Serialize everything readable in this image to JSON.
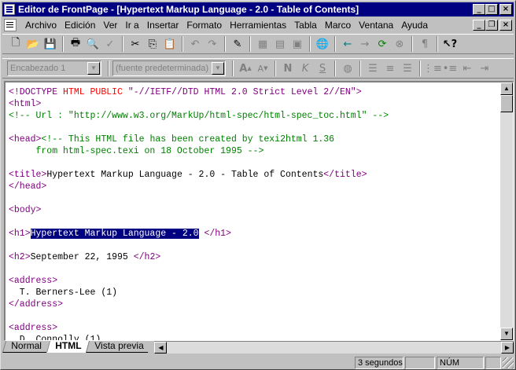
{
  "window": {
    "title": "Editor de FrontPage - [Hypertext Markup Language - 2.0 - Table of Contents]",
    "buttons": {
      "minimize": "_",
      "maximize": "□",
      "close": "×"
    }
  },
  "menu": {
    "items": [
      "Archivo",
      "Edición",
      "Ver",
      "Ir a",
      "Insertar",
      "Formato",
      "Herramientas",
      "Tabla",
      "Marco",
      "Ventana",
      "Ayuda"
    ],
    "mdi": {
      "minimize": "_",
      "restore": "❐",
      "close": "×"
    }
  },
  "format_toolbar": {
    "style_combo": "Encabezado 1",
    "font_combo": "(fuente predeterminada)"
  },
  "code_lines": [
    [
      {
        "c": "tag",
        "t": "<!DOCTYPE "
      },
      {
        "c": "attr",
        "t": "HTML PUBLIC "
      },
      {
        "c": "tag",
        "t": "\"-//IETF//DTD HTML 2.0 Strict Level 2//EN\">"
      }
    ],
    [
      {
        "c": "tag",
        "t": "<html>"
      }
    ],
    [
      {
        "c": "comment",
        "t": "<!-- Url : \"http://www.w3.org/MarkUp/html-spec/html-spec_toc.html\" -->"
      }
    ],
    [],
    [
      {
        "c": "tag",
        "t": "<head>"
      },
      {
        "c": "comment",
        "t": "<!-- This HTML file has been created by texi2html 1.36"
      }
    ],
    [
      {
        "c": "comment",
        "t": "     from html-spec.texi on 18 October 1995 -->"
      }
    ],
    [],
    [
      {
        "c": "tag",
        "t": "<title>"
      },
      {
        "c": "txt",
        "t": "Hypertext Markup Language - 2.0 - Table of Contents"
      },
      {
        "c": "tag",
        "t": "</title>"
      }
    ],
    [
      {
        "c": "tag",
        "t": "</head>"
      }
    ],
    [],
    [
      {
        "c": "tag",
        "t": "<body>"
      }
    ],
    [],
    [
      {
        "c": "tag",
        "t": "<h1>"
      },
      {
        "c": "sel",
        "t": "Hypertext Markup Language - 2.0"
      },
      {
        "c": "txt",
        "t": " "
      },
      {
        "c": "tag",
        "t": "</h1>"
      }
    ],
    [],
    [
      {
        "c": "tag",
        "t": "<h2>"
      },
      {
        "c": "txt",
        "t": "September 22, 1995 "
      },
      {
        "c": "tag",
        "t": "</h2>"
      }
    ],
    [],
    [
      {
        "c": "tag",
        "t": "<address>"
      }
    ],
    [
      {
        "c": "txt",
        "t": "  T. Berners-Lee (1)"
      }
    ],
    [
      {
        "c": "tag",
        "t": "</address>"
      }
    ],
    [],
    [
      {
        "c": "tag",
        "t": "<address>"
      }
    ],
    [
      {
        "c": "txt",
        "t": "  D. Connolly (1)"
      }
    ]
  ],
  "tabs": [
    {
      "label": "Normal",
      "active": false
    },
    {
      "label": "HTML",
      "active": true
    },
    {
      "label": "Vista previa",
      "active": false
    }
  ],
  "status": {
    "message": "",
    "time": "3 segundos",
    "indicator1": "",
    "num": "NÚM",
    "indicator2": ""
  }
}
